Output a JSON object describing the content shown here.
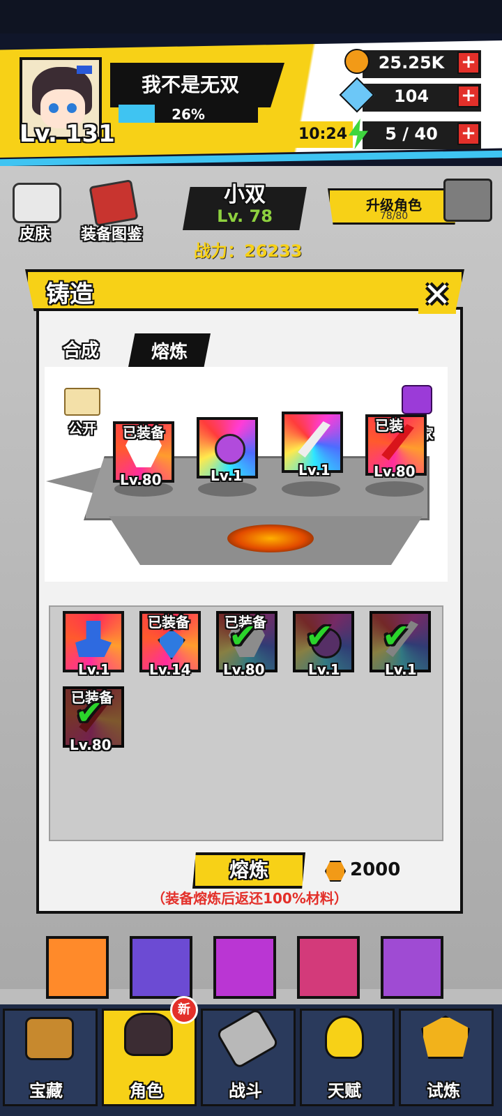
{
  "player": {
    "name": "我不是无双",
    "level": "Lv. 131",
    "exp_percent_label": "26%",
    "exp_fraction": 0.26
  },
  "resources": {
    "paw_coins": "25.25K",
    "gems": "104",
    "energy_timer": "10:24",
    "energy": "5 / 40"
  },
  "left_buttons": {
    "skin": "皮肤",
    "codex": "装备图鉴"
  },
  "character": {
    "name": "小双",
    "level": "Lv. 78",
    "power": "战力：26233",
    "upgrade_label": "升级角色",
    "upgrade_count": "78/80"
  },
  "dialog": {
    "title": "铸造",
    "close_icon": "close-icon",
    "tabs": [
      "合成",
      "熔炼"
    ],
    "active_tab": "熔炼",
    "public_tag": "公开",
    "exclusive_tag": "独家"
  },
  "forge_slots": [
    {
      "tag": "已装备",
      "level": "Lv.80",
      "icon": "uniform-icon"
    },
    {
      "tag": "",
      "level": "Lv.1",
      "icon": "pendant-icon"
    },
    {
      "tag": "",
      "level": "Lv.1",
      "icon": "blade-icon"
    },
    {
      "tag": "已装",
      "level": "Lv.80",
      "icon": "red-blade-icon"
    }
  ],
  "inventory": [
    {
      "tag": "",
      "level": "Lv.1",
      "icon": "glove-icon",
      "checked": false
    },
    {
      "tag": "已装备",
      "level": "Lv.14",
      "icon": "gem-necklace-icon",
      "checked": false
    },
    {
      "tag": "已装备",
      "level": "Lv.80",
      "icon": "uniform-icon",
      "checked": true
    },
    {
      "tag": "",
      "level": "Lv.1",
      "icon": "pendant-icon",
      "checked": true
    },
    {
      "tag": "",
      "level": "Lv.1",
      "icon": "blade-icon",
      "checked": true
    },
    {
      "tag": "已装备",
      "level": "Lv.80",
      "icon": "red-blade-icon",
      "checked": true
    }
  ],
  "smelt": {
    "button_label": "熔炼",
    "cost": "2000",
    "note": "（装备熔炼后返还100%材料）"
  },
  "nav": {
    "items": [
      "宝藏",
      "角色",
      "战斗",
      "天赋",
      "试炼"
    ],
    "active": "角色",
    "new_badge": "新"
  },
  "colors": {
    "accent_yellow": "#f7d117",
    "accent_blue": "#3fc4f2",
    "plus_red": "#e3302a",
    "check_green": "#2bd42b"
  }
}
